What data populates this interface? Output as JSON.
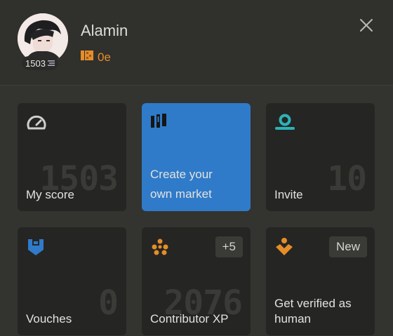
{
  "profile": {
    "name": "Alamin",
    "score": "1503",
    "balance": "0e"
  },
  "cards": {
    "my_score": {
      "label": "My score",
      "big": "1503"
    },
    "create_market": {
      "label_line1": "Create your",
      "label_line2": "own market"
    },
    "invite": {
      "label": "Invite",
      "big": "10"
    },
    "vouches": {
      "label": "Vouches",
      "big": "0"
    },
    "contributor_xp": {
      "label": "Contributor XP",
      "big": "2076",
      "badge": "+5"
    },
    "get_verified": {
      "label_line1": "Get verified as",
      "label_line2": "human",
      "badge": "New"
    }
  },
  "colors": {
    "accent_blue": "#2f7bc9",
    "accent_orange": "#e58d29",
    "accent_teal": "#2bb3b8"
  },
  "icons": {
    "score": "gauge-icon",
    "market": "market-bars-icon",
    "invite": "invite-icon",
    "vouches": "shield-icon",
    "contributor": "sparkle-icon",
    "verified": "diamond-icon",
    "close": "close-icon"
  }
}
